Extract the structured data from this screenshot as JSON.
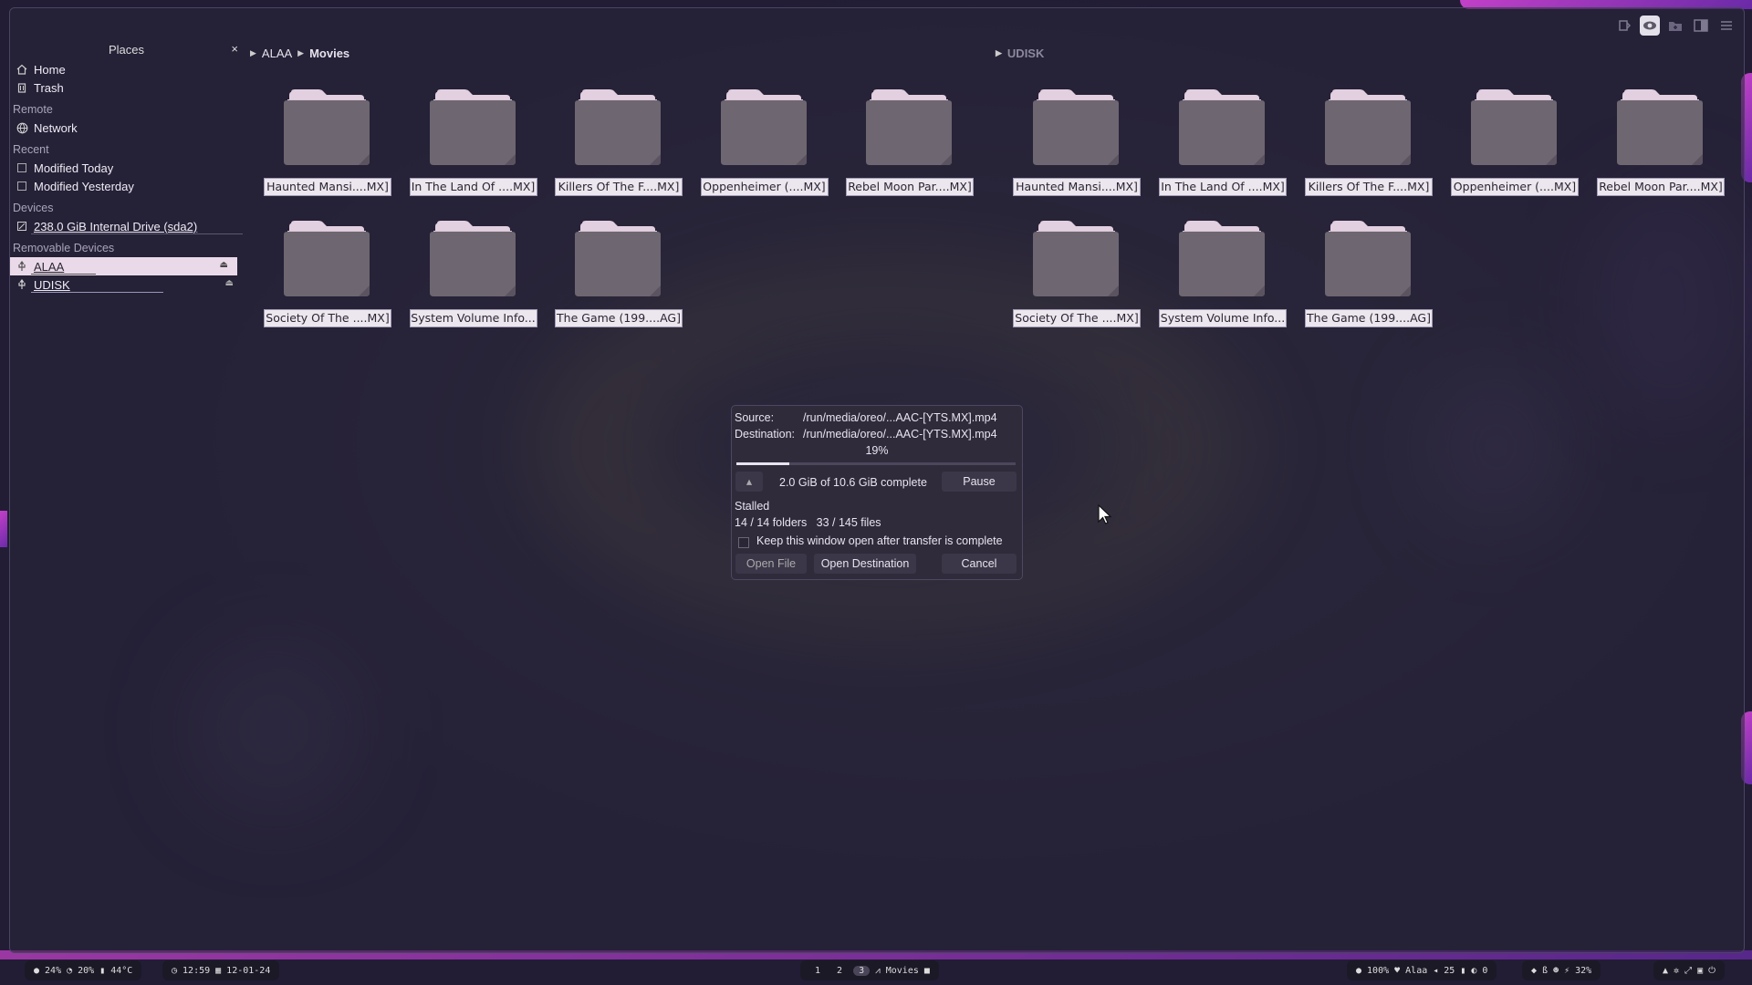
{
  "sidebar": {
    "title": "Places",
    "close": "×",
    "home": "Home",
    "trash": "Trash",
    "remote_header": "Remote",
    "network": "Network",
    "recent_header": "Recent",
    "modified_today": "Modified Today",
    "modified_yesterday": "Modified Yesterday",
    "devices_header": "Devices",
    "internal_drive": "238.0 GiB Internal Drive (sda2)",
    "removable_header": "Removable Devices",
    "alaa": "ALAA",
    "udisk": "UDISK",
    "alaa_usage": 0.43,
    "udisk_usage": 0.88
  },
  "left_pane": {
    "crumbs": [
      "ALAA",
      "Movies"
    ],
    "folders": [
      "Haunted Mansi....MX]",
      "In The Land Of ....MX]",
      "Killers Of The F....MX]",
      "Oppenheimer (....MX]",
      "Rebel Moon Par....MX]",
      "Society Of The ....MX]",
      "System Volume Info...",
      "The Game (199....AG]"
    ]
  },
  "right_pane": {
    "crumbs": [
      "UDISK"
    ],
    "folders": [
      "Haunted Mansi....MX]",
      "In The Land Of ....MX]",
      "Killers Of The F....MX]",
      "Oppenheimer (....MX]",
      "Rebel Moon Par....MX]",
      "Society Of The ....MX]",
      "System Volume Info...",
      "The Game (199....AG]"
    ]
  },
  "transfer": {
    "source_label": "Source:",
    "source": "/run/media/oreo/...AAC-[YTS.MX].mp4",
    "dest_label": "Destination:",
    "dest": "/run/media/oreo/...AAC-[YTS.MX].mp4",
    "percent_text": "19%",
    "progress": 0.19,
    "complete_text": "2.0 GiB of 10.6 GiB complete",
    "pause": "Pause",
    "status": "Stalled",
    "folders_count": "14 / 14 folders",
    "files_count": "33 / 145 files",
    "keep_open": "Keep this window open after transfer is complete",
    "open_file": "Open File",
    "open_destination": "Open Destination",
    "cancel": "Cancel"
  },
  "panel": {
    "cpu": "24%",
    "mem": "20%",
    "temp": "44°C",
    "time": "12:59",
    "date": "12-01-24",
    "workspaces": [
      "1",
      "2",
      "3"
    ],
    "active_window": "Movies",
    "brightness": "100%",
    "user": "Alaa",
    "volume": "25",
    "mic": "0",
    "battery": "32%"
  }
}
